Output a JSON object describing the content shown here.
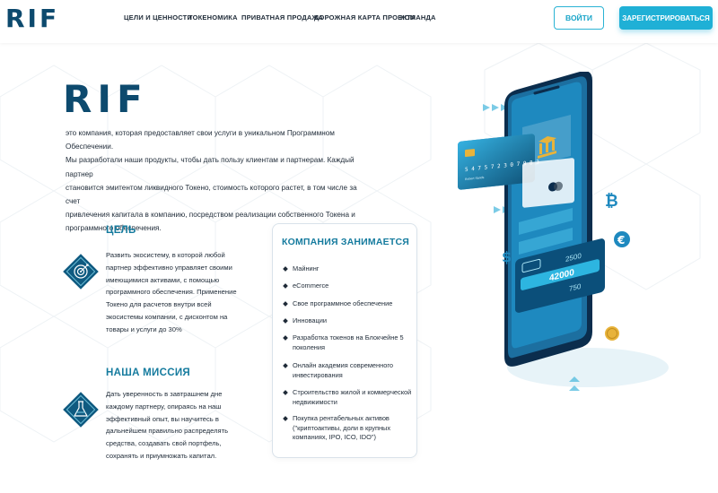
{
  "header": {
    "logo": "RIF",
    "nav": [
      {
        "label": "ЦЕЛИ И ЦЕННОСТИ"
      },
      {
        "label": "ТОКЕНОМИКА"
      },
      {
        "label": "ПРИВАТНАЯ ПРОДАЖА"
      },
      {
        "label": "ДОРОЖНАЯ КАРТА ПРОЕКТА"
      },
      {
        "label": "КОМАНДА"
      }
    ],
    "login_label": "ВОЙТИ",
    "register_label": "ЗАРЕГИСТРИРОВАТЬСЯ"
  },
  "hero": {
    "logo": "RIF",
    "lines": [
      "это компания, которая предоставляет свои услуги в уникальном Программном Обеспечении.",
      "Мы разработали наши продукты, чтобы дать пользу клиентам и партнерам. Каждый партнер",
      "становится эмитентом ликвидного Токено, стоимость которого растет, в том числе за счет",
      "привлечения  капитала в компанию, посредством реализации собственного Токена и",
      "программного обеспечения."
    ]
  },
  "goal": {
    "title": "ЦЕЛЬ",
    "icon": "target-icon",
    "lines": [
      "Развить экосистему, в которой любой",
      "партнер эффективно управляет своими",
      "имеющимися  активами, с помощью",
      "программного обеспечения. Применение",
      "Токено для расчетов внутри всей",
      "экосистемы компании, с дисконтом на",
      "товары и услуги до 30%"
    ]
  },
  "mission": {
    "title": "НАША МИССИЯ",
    "icon": "flask-icon",
    "lines": [
      "Дать уверенность в завтрашнем дне",
      "каждому партнеру, опираясь на наш",
      "эффективный опыт, вы научитесь в",
      "дальнейшем правильно распределять",
      "средства, создавать свой портфель,",
      "сохранять и приумножать капитал."
    ]
  },
  "company": {
    "title": "КОМПАНИЯ ЗАНИМАЕТСЯ",
    "items": [
      [
        "Майнинг"
      ],
      [
        "eCommerce"
      ],
      [
        "Свое программное обеспечение"
      ],
      [
        "Инновации"
      ],
      [
        "Разработка токенов на Блокчейне 5",
        "поколения"
      ],
      [
        "Онлайн академия современного",
        "инвестирования"
      ],
      [
        "Строительство жилой и коммерческой",
        "недвижимости"
      ],
      [
        "Покупка  рентабельных активов",
        "(\"криптоактивы, доли в крупных",
        "компаниях, IPO, ICO, IDO\")"
      ]
    ]
  },
  "illustration": {
    "card_number": "5 4 7 5   7 2 3 0   7 9 8 3",
    "card_holder": "Robert Sands",
    "amounts": [
      "2500",
      "42000",
      "750"
    ],
    "currency_icons": [
      "bitcoin-icon",
      "euro-icon",
      "dollar-icon"
    ],
    "colors": {
      "primary": "#1fb0d6",
      "dark": "#0d4a6e",
      "accent": "#157b9e",
      "gold": "#e8b33a"
    }
  }
}
